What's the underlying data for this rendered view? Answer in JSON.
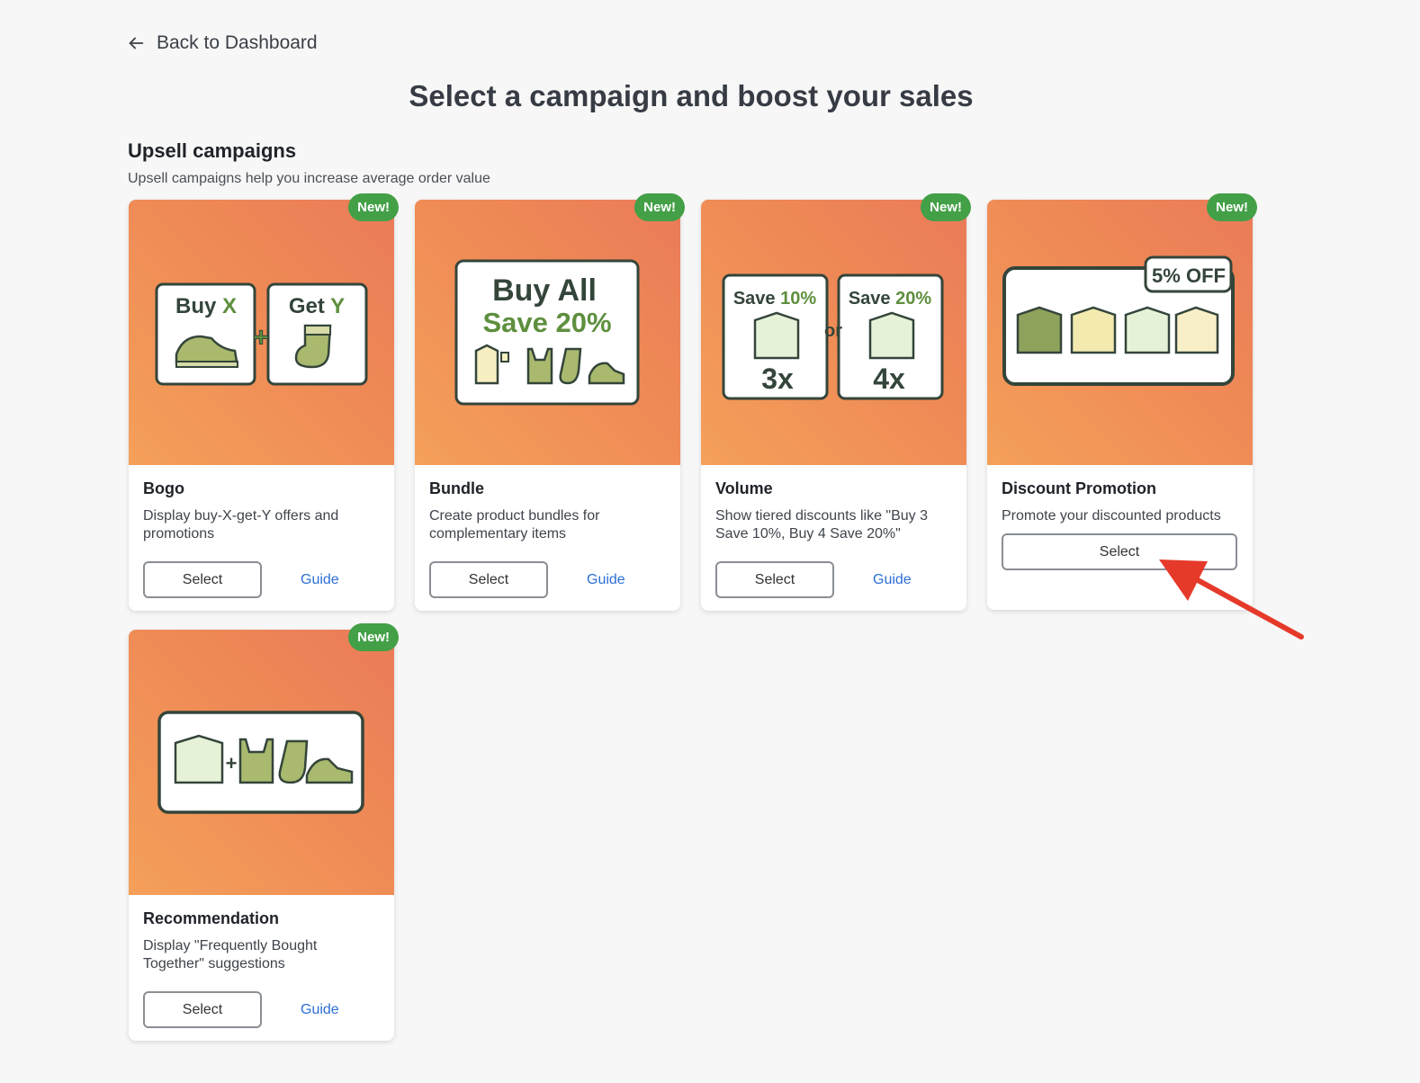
{
  "nav": {
    "back_label": "Back to Dashboard"
  },
  "page": {
    "title": "Select a campaign and boost your sales"
  },
  "section": {
    "title": "Upsell campaigns",
    "subtitle": "Upsell campaigns help you increase average order value"
  },
  "badge_label": "New!",
  "cards": [
    {
      "name": "Bogo",
      "description": "Display buy-X-get-Y offers and promotions",
      "select_label": "Select",
      "guide_label": "Guide",
      "art": {
        "left_label": "Buy",
        "left_accent": "X",
        "right_label": "Get",
        "right_accent": "Y"
      }
    },
    {
      "name": "Bundle",
      "description": "Create product bundles for complementary items",
      "select_label": "Select",
      "guide_label": "Guide",
      "art": {
        "line1": "Buy All",
        "line2": "Save 20%"
      }
    },
    {
      "name": "Volume",
      "description": "Show tiered discounts like \"Buy 3 Save 10%, Buy 4 Save 20%\"",
      "select_label": "Select",
      "guide_label": "Guide",
      "art": {
        "left_save": "Save",
        "left_pct": "10%",
        "left_qty": "3x",
        "or": "or",
        "right_save": "Save",
        "right_pct": "20%",
        "right_qty": "4x"
      }
    },
    {
      "name": "Discount Promotion",
      "description": "Promote your discounted products",
      "select_label": "Select",
      "art": {
        "tag": "5% OFF"
      }
    },
    {
      "name": "Recommendation",
      "description": "Display \"Frequently Bought Together\" suggestions",
      "select_label": "Select",
      "guide_label": "Guide"
    }
  ],
  "colors": {
    "accent_green": "#43a047",
    "hero_orange": "#ef8a56",
    "link_blue": "#2c6fd6",
    "annotation_red": "#e53a2a"
  }
}
